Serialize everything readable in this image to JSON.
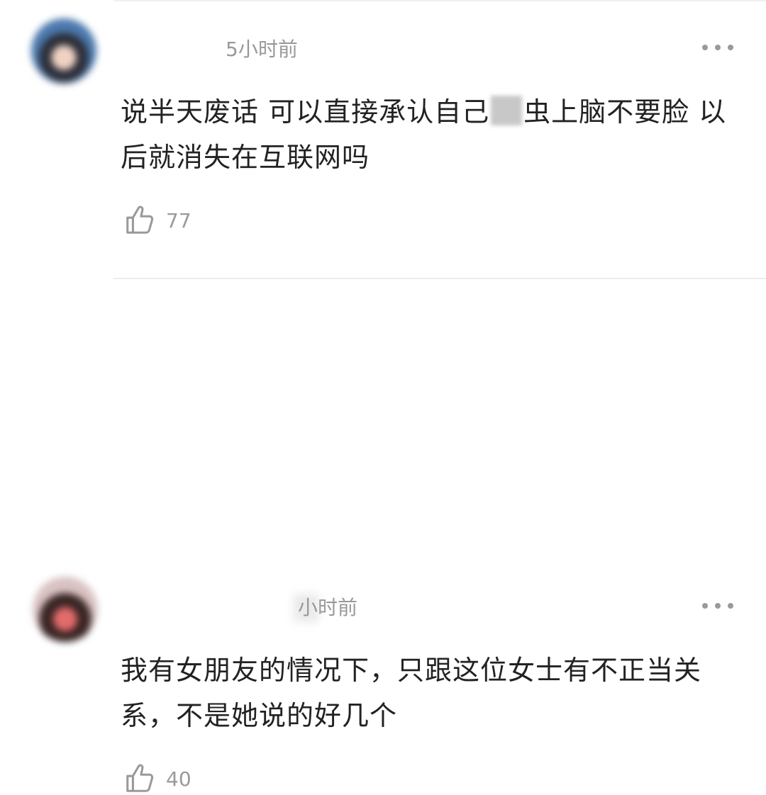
{
  "comments": [
    {
      "username": "",
      "timestamp": "5小时前",
      "content_part1": "说半天废话 可以直接承认自己",
      "content_part2": "虫上脑不要脸 以后就消失在互联网吗",
      "like_icon": "thumbs-up-icon",
      "likes": "77"
    },
    {
      "username": "",
      "timestamp": "小时前",
      "content": "我有女朋友的情况下，只跟这位女士有不正当关系，不是她说的好几个",
      "like_icon": "thumbs-up-icon",
      "likes": "40"
    }
  ],
  "colors": {
    "text": "#222222",
    "meta": "#999999",
    "divider": "#ececec"
  }
}
